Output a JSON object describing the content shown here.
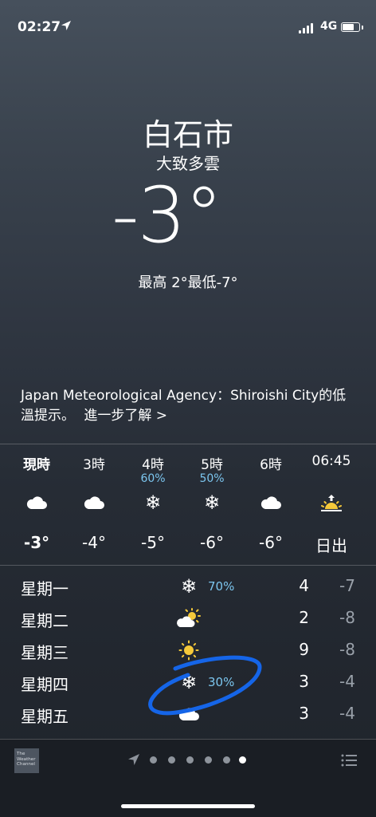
{
  "status_bar": {
    "time": "02:27",
    "network": "4G"
  },
  "location": {
    "city": "白石市",
    "condition": "大致多雲",
    "temperature": "-3°",
    "hi_lo": "最高 2°最低-7°"
  },
  "alert": {
    "text": "Japan Meteorological Agency：Shiroishi City的低溫提示。",
    "more": "進一步了解 >"
  },
  "hourly": [
    {
      "label": "現時",
      "precip": "",
      "icon": "cloud-icon",
      "temp": "-3°"
    },
    {
      "label": "3時",
      "precip": "",
      "icon": "cloud-icon",
      "temp": "-4°"
    },
    {
      "label": "4時",
      "precip": "60%",
      "icon": "snowflake-icon",
      "temp": "-5°"
    },
    {
      "label": "5時",
      "precip": "50%",
      "icon": "snowflake-icon",
      "temp": "-6°"
    },
    {
      "label": "6時",
      "precip": "",
      "icon": "cloud-icon",
      "temp": "-6°"
    },
    {
      "label": "06:45",
      "precip": "",
      "icon": "sunrise-icon",
      "temp": "日出"
    }
  ],
  "daily": [
    {
      "day": "星期一",
      "icon": "snowflake-icon",
      "precip": "70%",
      "high": "4",
      "low": "-7"
    },
    {
      "day": "星期二",
      "icon": "partly-cloudy-icon",
      "precip": "",
      "high": "2",
      "low": "-8"
    },
    {
      "day": "星期三",
      "icon": "sun-icon",
      "precip": "",
      "high": "9",
      "low": "-8"
    },
    {
      "day": "星期四",
      "icon": "snowflake-icon",
      "precip": "30%",
      "high": "3",
      "low": "-4"
    },
    {
      "day": "星期五",
      "icon": "cloud-icon",
      "precip": "",
      "high": "3",
      "low": "-4"
    }
  ],
  "toolbar": {
    "logo": "The Weather Channel",
    "page_count": 6,
    "current_page": 6,
    "icons": [
      "location-arrow-icon",
      "list-icon"
    ]
  },
  "colors": {
    "precip": "#7cc6ef",
    "sun": "#f5c93a",
    "annotation": "#1565e8"
  }
}
